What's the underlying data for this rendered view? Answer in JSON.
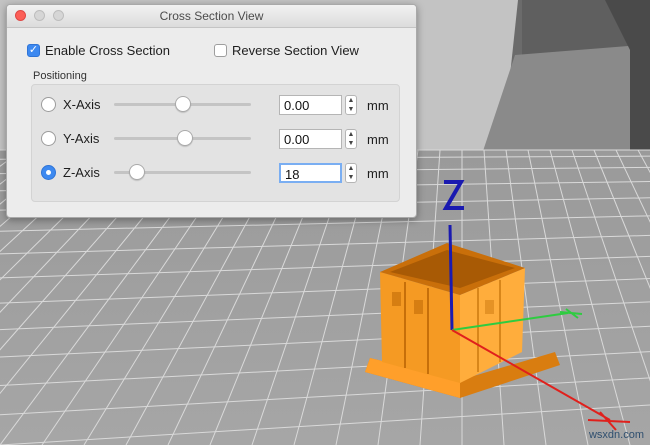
{
  "dialog": {
    "title": "Cross Section View",
    "enable_label": "Enable Cross Section",
    "enable_checked": true,
    "reverse_label": "Reverse Section View",
    "reverse_checked": false,
    "positioning_label": "Positioning",
    "axes": [
      {
        "label": "X-Axis",
        "value": "0.00",
        "unit": "mm",
        "selected": false,
        "slider_fraction": 0.5
      },
      {
        "label": "Y-Axis",
        "value": "0.00",
        "unit": "mm",
        "selected": false,
        "slider_fraction": 0.52
      },
      {
        "label": "Z-Axis",
        "value": "18",
        "unit": "mm",
        "selected": true,
        "slider_fraction": 0.17
      }
    ]
  },
  "viewport": {
    "axis_label": "Z",
    "model_color": "#f59a23",
    "z_axis_color": "#1a1ab0",
    "y_axis_color": "#2ecc40",
    "x_axis_color": "#e0201c"
  },
  "watermark": "wsxdn.com"
}
